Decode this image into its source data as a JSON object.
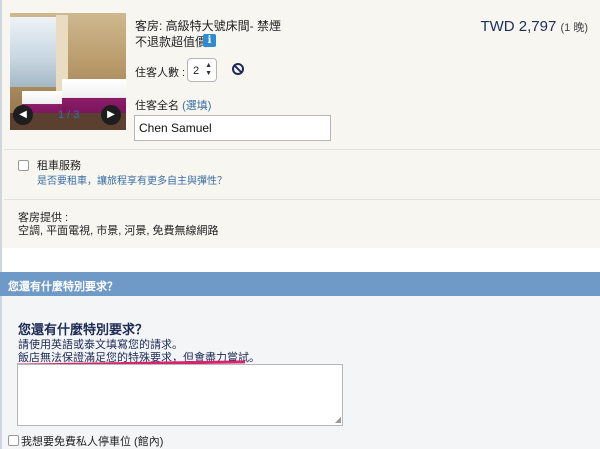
{
  "room": {
    "title": "客房: 高級特大號床間- 禁煙",
    "rate_type": "不退款超值價",
    "info_icon": "i",
    "price": "TWD 2,797",
    "nights": "(1 晚)",
    "photo_counter": "1 / 3",
    "prev_glyph": "◀",
    "next_glyph": "▶"
  },
  "guests": {
    "label": "住客人數 :",
    "selected": "2",
    "arrows": "▲▼"
  },
  "fullname": {
    "label": "住客全名",
    "optional": "(選填)",
    "value": "Chen Samuel"
  },
  "car_rental": {
    "title": "租車服務",
    "description": "是否要租車，讓旅程享有更多自主與彈性？"
  },
  "amenities": {
    "title": "客房提供 :",
    "list": "空調, 平面電視, 市景, 河景, 免費無線網路"
  },
  "special_requests": {
    "bar_title": "您還有什麼特別要求？",
    "title": "您還有什麼特別要求？",
    "line1": "請使用英語或泰文填寫您的請求。",
    "line2": "飯店無法保證滿足您的特殊要求，但會盡力嘗試。",
    "grip": "◢"
  },
  "parking": {
    "label": "我想要免費私人停車位 (館內)"
  },
  "colors": {
    "section_bar": "#6f9ac8",
    "link": "#3a6ea5",
    "heading": "#1d2b55",
    "highlight_underline": "#d6246e"
  }
}
